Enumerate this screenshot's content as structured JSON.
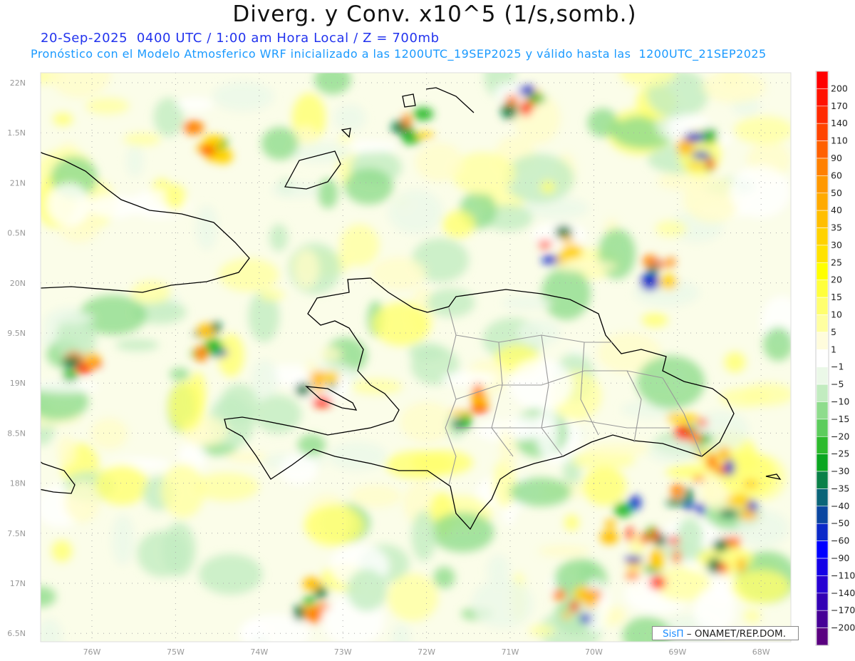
{
  "header": {
    "title": "Diverg. y Conv. x10^5 (1/s,somb.)",
    "valid_line": "20-Sep-2025  0400 UTC / 1:00 am Hora Local / Z = 700mb",
    "model_line": "Pronóstico con el Modelo Atmosferico WRF inicializado a las 1200UTC_19SEP2025 y válido hasta las  1200UTC_21SEP2025"
  },
  "axes": {
    "lat_labels": [
      "22N",
      "1.5N",
      "21N",
      "0.5N",
      "20N",
      "9.5N",
      "19N",
      "8.5N",
      "18N",
      "7.5N",
      "17N",
      "6.5N"
    ],
    "lon_labels": [
      "76W",
      "75W",
      "74W",
      "73W",
      "72W",
      "71W",
      "70W",
      "69W",
      "68W"
    ]
  },
  "colorbar": {
    "labels": [
      "200",
      "170",
      "140",
      "110",
      "90",
      "60",
      "50",
      "40",
      "35",
      "30",
      "25",
      "20",
      "15",
      "10",
      "5",
      "1",
      "-1",
      "-5",
      "-10",
      "-15",
      "-20",
      "-25",
      "-30",
      "-35",
      "-40",
      "-50",
      "-60",
      "-90",
      "-110",
      "-140",
      "-170",
      "-200"
    ],
    "colors": [
      "#ff0000",
      "#ff1200",
      "#ff2a00",
      "#ff4400",
      "#ff6000",
      "#ff8000",
      "#ff9800",
      "#ffaa00",
      "#ffbe00",
      "#ffd200",
      "#ffe200",
      "#ffff00",
      "#ffff3c",
      "#ffff6e",
      "#ffffa0",
      "#fffcdc",
      "#ffffff",
      "#ebf8e8",
      "#c2ecc0",
      "#8edc8c",
      "#5ccc5c",
      "#2cba2c",
      "#0aa520",
      "#0a8048",
      "#0a6478",
      "#0a46a0",
      "#0a28c8",
      "#0000ff",
      "#1400e6",
      "#2600d2",
      "#3200b4",
      "#460096",
      "#5a0080"
    ]
  },
  "watermark": {
    "brand": "SisΠ",
    "text": " – ONAMET/REP.DOM."
  }
}
